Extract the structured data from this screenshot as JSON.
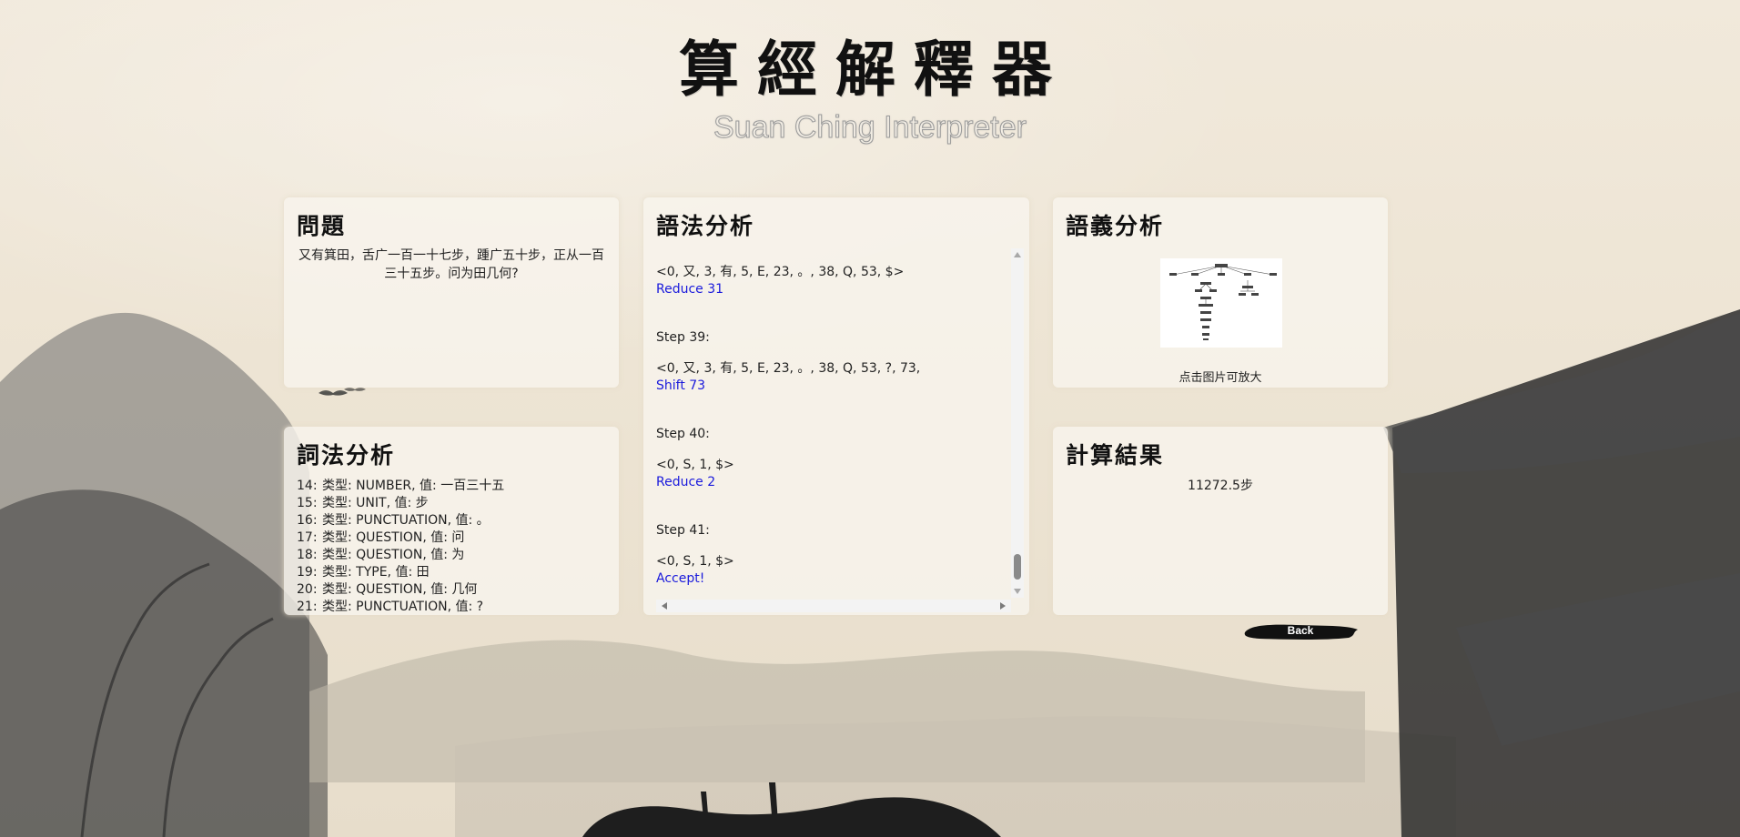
{
  "header": {
    "title": "算經解釋器",
    "subtitle": "Suan Ching Interpreter"
  },
  "question_panel": {
    "title": "問題",
    "text": "又有箕田，舌广一百一十七步，踵广五十步，正从一百三十五步。问为田几何?"
  },
  "lexical_panel": {
    "title": "詞法分析",
    "tokens": [
      {
        "idx": "14:",
        "text": "类型: NUMBER, 值: 一百三十五"
      },
      {
        "idx": "15:",
        "text": "类型: UNIT, 值: 步"
      },
      {
        "idx": "16:",
        "text": "类型: PUNCTUATION, 值: 。"
      },
      {
        "idx": "17:",
        "text": "类型: QUESTION, 值: 问"
      },
      {
        "idx": "18:",
        "text": "类型: QUESTION, 值: 为"
      },
      {
        "idx": "19:",
        "text": "类型: TYPE, 值: 田"
      },
      {
        "idx": "20:",
        "text": "类型: QUESTION, 值: 几何"
      },
      {
        "idx": "21:",
        "text": "类型: PUNCTUATION, 值: ?"
      }
    ]
  },
  "syntax_panel": {
    "title": "語法分析",
    "steps": [
      {
        "label": "",
        "stack": "<0, 又, 3, 有, 5, E, 23, 。, 38, Q, 53, $>",
        "action": "Reduce 31"
      },
      {
        "label": "Step 39:",
        "stack": "<0, 又, 3, 有, 5, E, 23, 。, 38, Q, 53, ?, 73,",
        "action": "Shift 73"
      },
      {
        "label": "Step 40:",
        "stack": "<0, S, 1, $>",
        "action": "Reduce 2"
      },
      {
        "label": "Step 41:",
        "stack": "<0, S, 1, $>",
        "action": "Accept!"
      }
    ]
  },
  "semantic_panel": {
    "title": "語義分析",
    "hint": "点击图片可放大"
  },
  "result_panel": {
    "title": "計算結果",
    "value": "11272.5步"
  },
  "back_button": {
    "label": "Back"
  }
}
